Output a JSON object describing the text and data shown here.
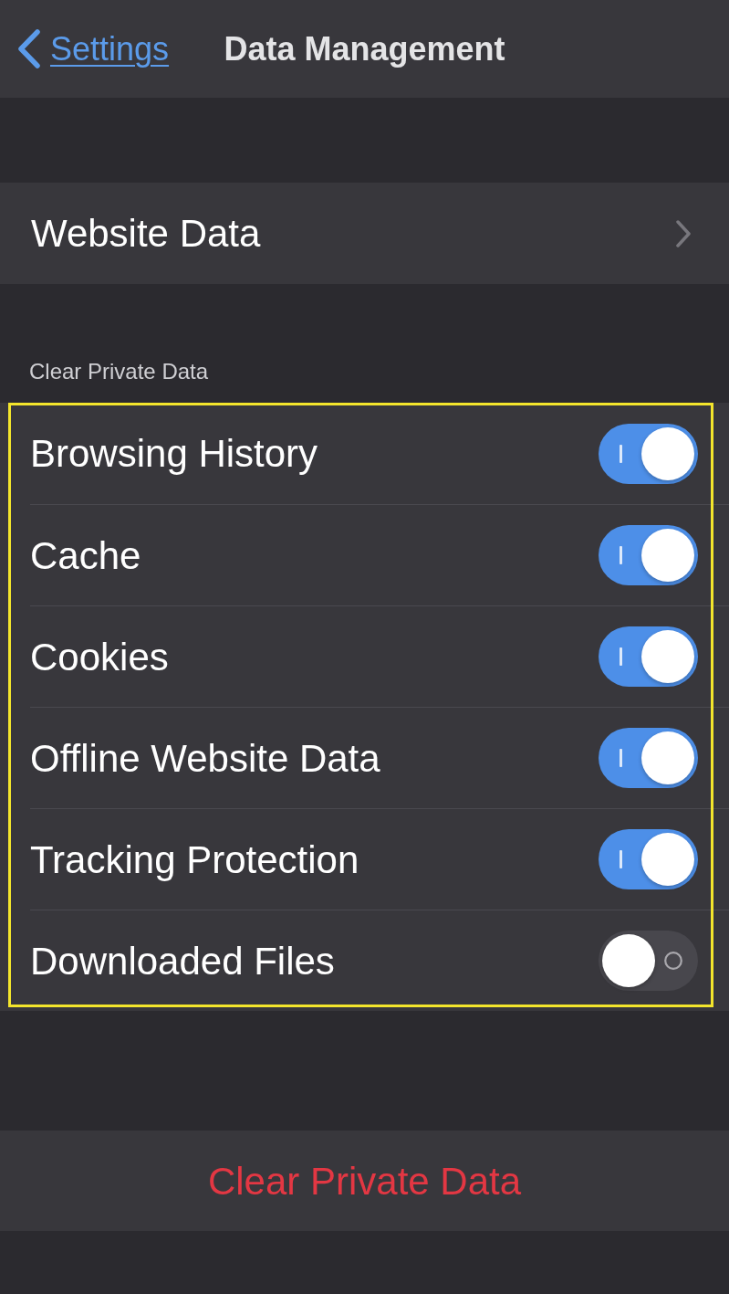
{
  "nav": {
    "back_label": "Settings",
    "title": "Data Management"
  },
  "website_data": {
    "label": "Website Data"
  },
  "section": {
    "header": "Clear Private Data"
  },
  "toggles": [
    {
      "label": "Browsing History",
      "on": true
    },
    {
      "label": "Cache",
      "on": true
    },
    {
      "label": "Cookies",
      "on": true
    },
    {
      "label": "Offline Website Data",
      "on": true
    },
    {
      "label": "Tracking Protection",
      "on": true
    },
    {
      "label": "Downloaded Files",
      "on": false
    }
  ],
  "clear_button": {
    "label": "Clear Private Data"
  }
}
